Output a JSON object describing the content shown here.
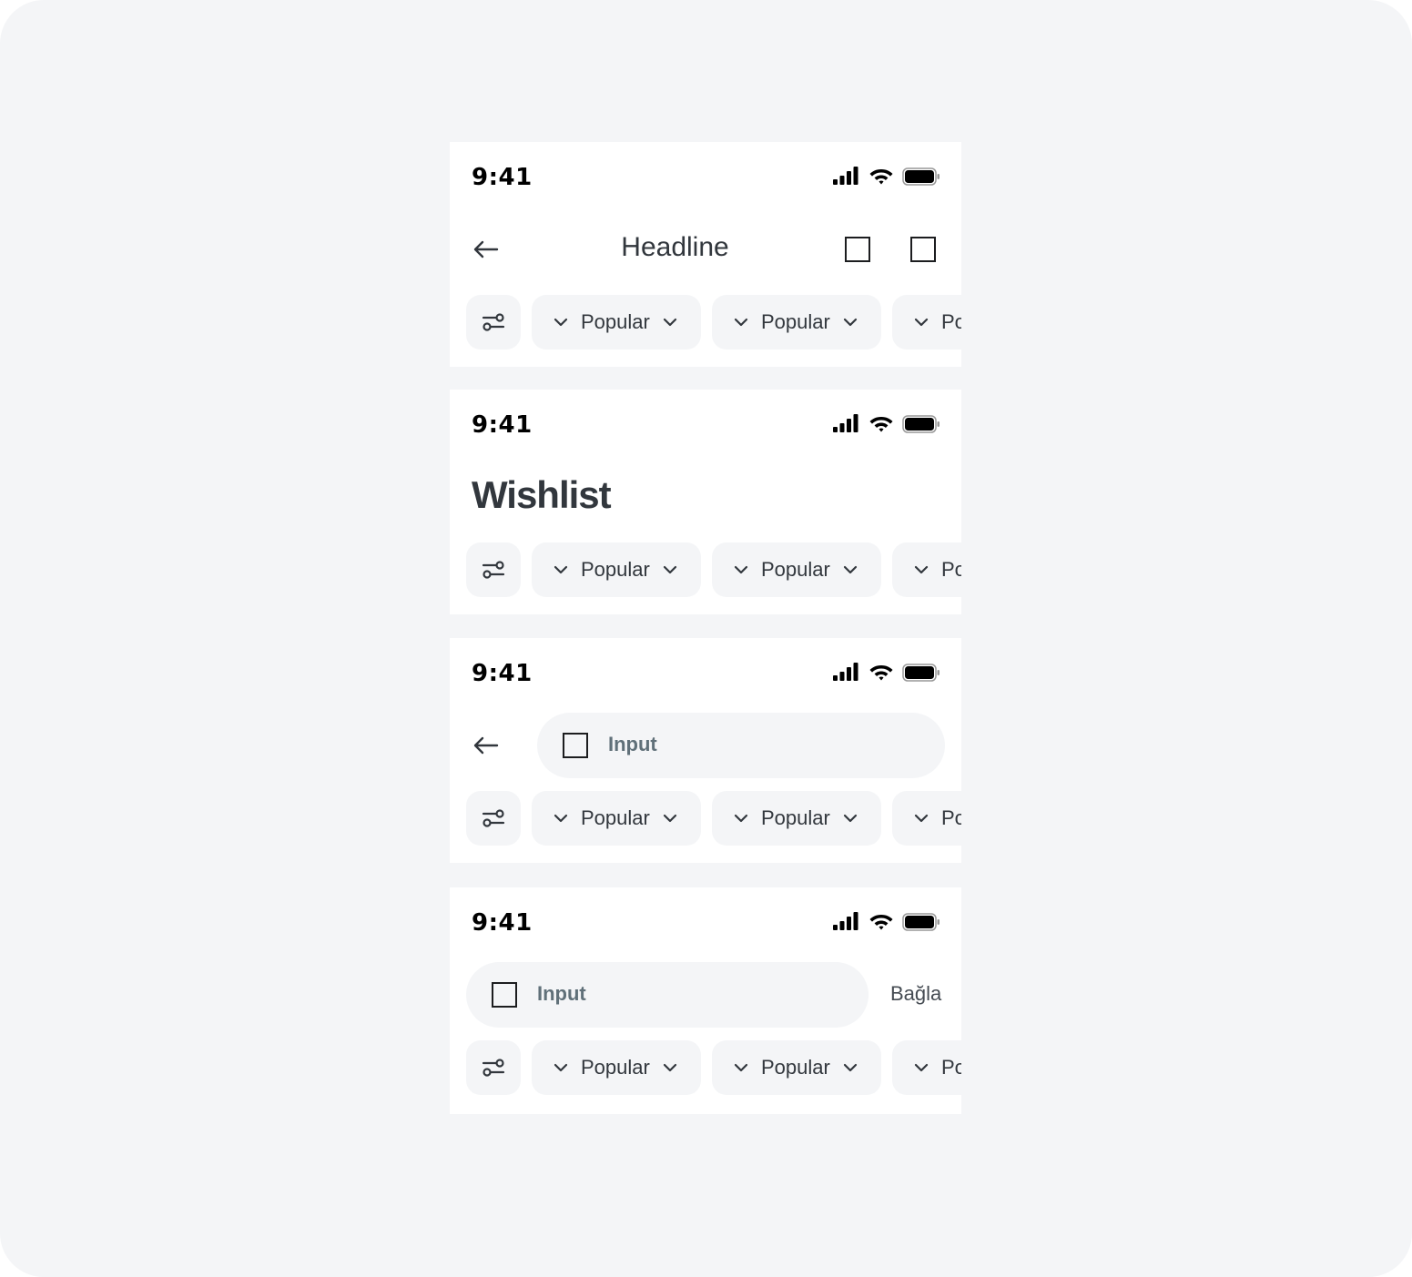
{
  "status": {
    "time": "9:41"
  },
  "screens": [
    {
      "variant": "headline",
      "title": "Headline",
      "chips": [
        "Popular",
        "Popular",
        "Popular"
      ]
    },
    {
      "variant": "large-title",
      "title": "Wishlist",
      "chips": [
        "Popular",
        "Popular",
        "Popular"
      ]
    },
    {
      "variant": "search-with-back",
      "search_placeholder": "Input",
      "chips": [
        "Popular",
        "Popular",
        "Popular"
      ]
    },
    {
      "variant": "search-with-action",
      "search_placeholder": "Input",
      "action_label": "Bağla",
      "chips": [
        "Popular",
        "Popular",
        "Popular"
      ]
    }
  ],
  "colors": {
    "background": "#f4f5f7",
    "surface": "#ffffff",
    "text_primary": "#32373d",
    "placeholder": "#607079"
  }
}
